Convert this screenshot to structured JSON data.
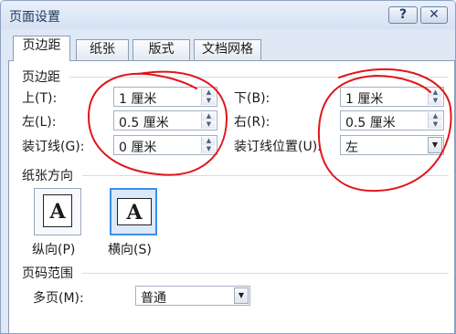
{
  "window": {
    "title": "页面设置",
    "help_label": "?",
    "close_label": "✕"
  },
  "tabs": [
    {
      "label": "页边距",
      "active": true
    },
    {
      "label": "纸张",
      "active": false
    },
    {
      "label": "版式",
      "active": false
    },
    {
      "label": "文档网格",
      "active": false
    }
  ],
  "margins": {
    "section_title": "页边距",
    "top": {
      "label": "上(T):",
      "value": "1 厘米"
    },
    "bottom": {
      "label": "下(B):",
      "value": "1 厘米"
    },
    "left": {
      "label": "左(L):",
      "value": "0.5 厘米"
    },
    "right": {
      "label": "右(R):",
      "value": "0.5 厘米"
    },
    "gutter": {
      "label": "装订线(G):",
      "value": "0 厘米"
    },
    "gutter_position": {
      "label": "装订线位置(U):",
      "value": "左"
    }
  },
  "orientation": {
    "section_title": "纸张方向",
    "portrait_label": "纵向(P)",
    "landscape_label": "横向(S)",
    "icon_letter": "A",
    "selected": "landscape"
  },
  "pages": {
    "section_title": "页码范围",
    "multiple_label": "多页(M):",
    "multiple_value": "普通"
  },
  "colors": {
    "annotation": "#e0161b",
    "selection": "#3d8ee8",
    "title": "#1e395b"
  }
}
